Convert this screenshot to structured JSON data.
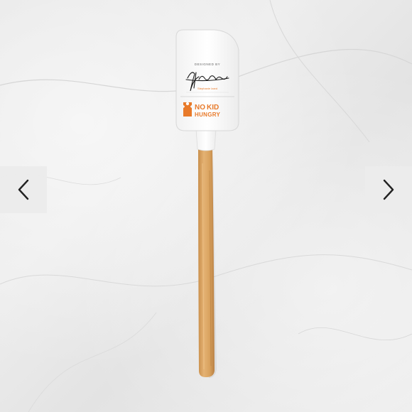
{
  "gallery": {
    "prev_icon": "chevron-left-icon",
    "next_icon": "chevron-right-icon"
  },
  "product": {
    "label": {
      "designed_by": "DESIGNED BY",
      "signature_name": "Stephanie Izard",
      "brand_line1": "NO",
      "brand_line1_accent": "KID",
      "brand_line2": "HUNGRY",
      "brand_color": "#e87a2a"
    }
  }
}
